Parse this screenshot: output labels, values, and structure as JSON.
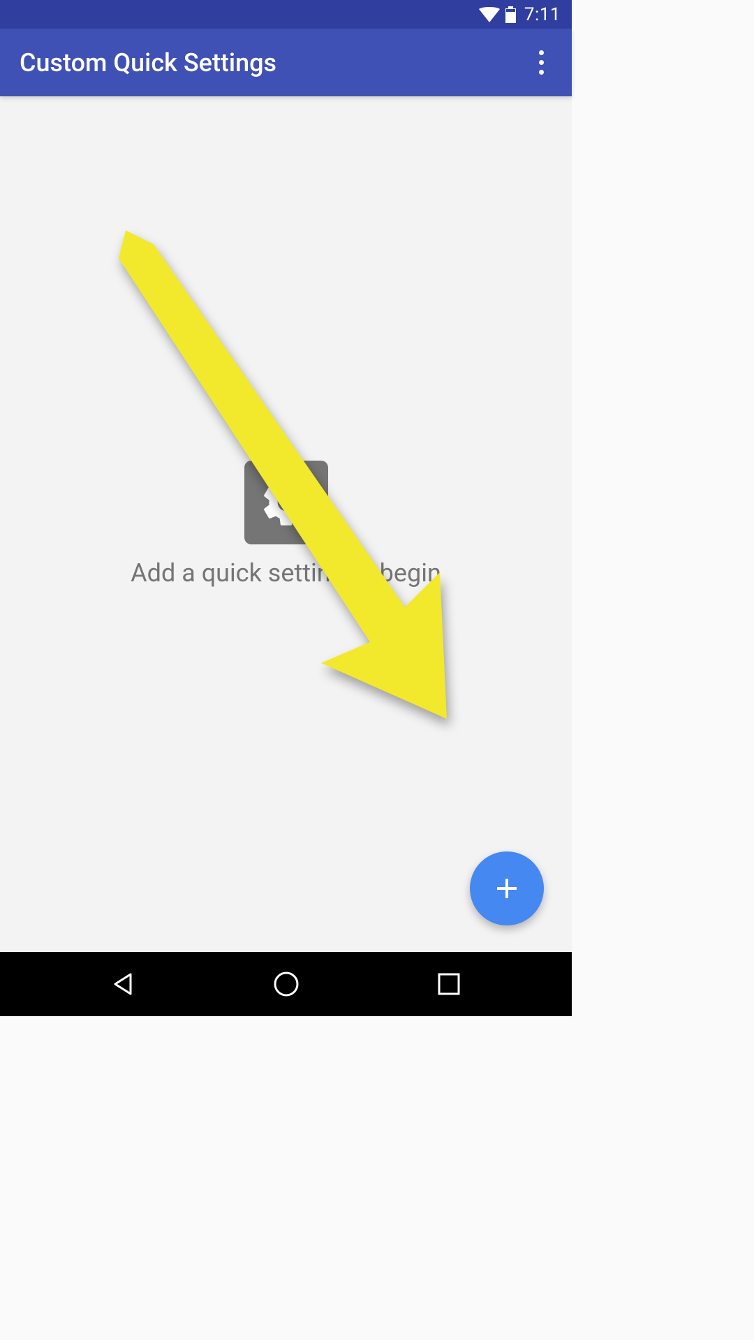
{
  "status": {
    "time": "7:11"
  },
  "app_bar": {
    "title": "Custom Quick Settings"
  },
  "empty_state": {
    "message": "Add a quick setting to begin"
  },
  "icons": {
    "wifi": "wifi-icon",
    "battery": "battery-icon",
    "gear": "gear-icon",
    "plus": "plus-icon",
    "overflow": "overflow-icon",
    "back": "back-icon",
    "home": "home-icon",
    "recents": "recents-icon",
    "arrow": "annotation-arrow"
  },
  "colors": {
    "primary": "#3f51b5",
    "primary_dark": "#303f9f",
    "fab": "#4688f1",
    "arrow": "#f2e92c"
  }
}
